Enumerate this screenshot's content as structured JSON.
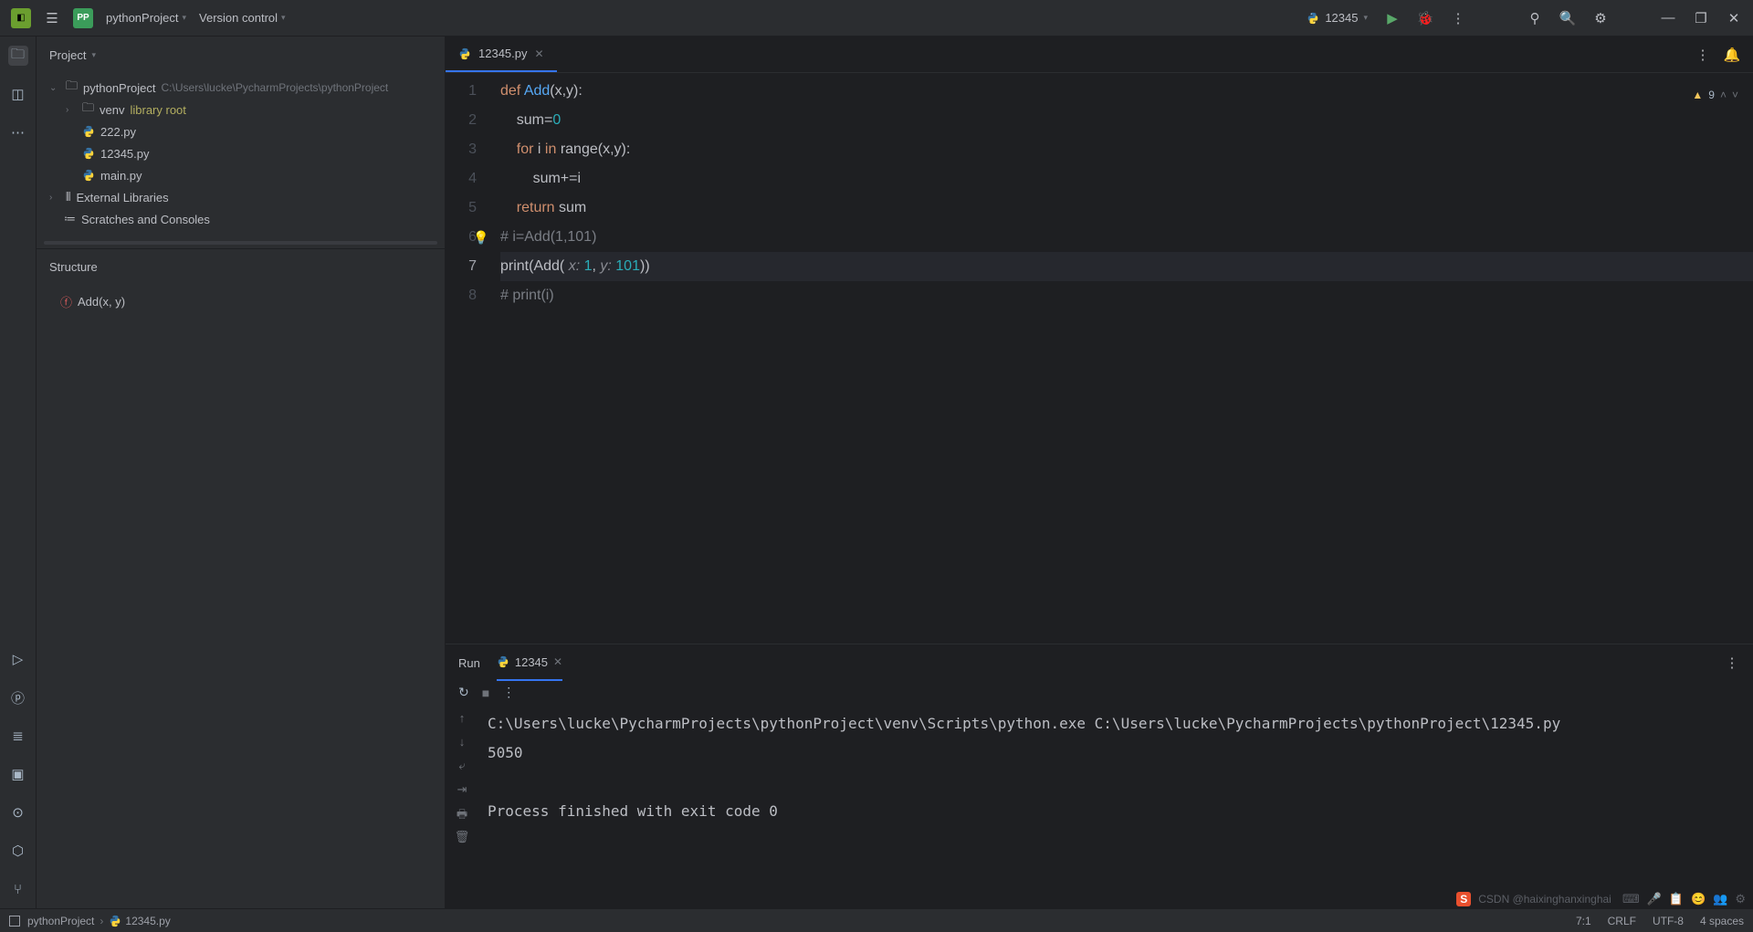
{
  "titlebar": {
    "project_name": "pythonProject",
    "version_control": "Version control",
    "run_config": "12345"
  },
  "sidebar": {
    "header": "Project",
    "project": {
      "name": "pythonProject",
      "path": "C:\\Users\\lucke\\PycharmProjects\\pythonProject"
    },
    "venv": {
      "name": "venv",
      "tag": "library root"
    },
    "files": [
      "222.py",
      "12345.py",
      "main.py"
    ],
    "external": "External Libraries",
    "scratches": "Scratches and Consoles",
    "structure_header": "Structure",
    "structure_item": "Add(x, y)"
  },
  "editor": {
    "tab": "12345.py",
    "warnings": "9",
    "lines": [
      {
        "n": "1",
        "segs": [
          {
            "t": "def ",
            "c": "kw"
          },
          {
            "t": "Add",
            "c": "fn"
          },
          {
            "t": "(x,y):",
            "c": ""
          }
        ]
      },
      {
        "n": "2",
        "segs": [
          {
            "t": "    sum=",
            "c": ""
          },
          {
            "t": "0",
            "c": "num"
          }
        ]
      },
      {
        "n": "3",
        "segs": [
          {
            "t": "    ",
            "c": ""
          },
          {
            "t": "for ",
            "c": "kw"
          },
          {
            "t": "i ",
            "c": ""
          },
          {
            "t": "in ",
            "c": "kw"
          },
          {
            "t": "range(x,y):",
            "c": ""
          }
        ]
      },
      {
        "n": "4",
        "segs": [
          {
            "t": "        sum+=i",
            "c": ""
          }
        ]
      },
      {
        "n": "5",
        "segs": [
          {
            "t": "    ",
            "c": ""
          },
          {
            "t": "return ",
            "c": "kw"
          },
          {
            "t": "sum",
            "c": ""
          }
        ]
      },
      {
        "n": "6",
        "segs": [
          {
            "t": "# i=Add(1,101)",
            "c": "comment"
          }
        ],
        "bulb": true
      },
      {
        "n": "7",
        "segs": [
          {
            "t": "print(Add( ",
            "c": ""
          },
          {
            "t": "x: ",
            "c": "param"
          },
          {
            "t": "1",
            "c": "num"
          },
          {
            "t": ", ",
            "c": ""
          },
          {
            "t": "y: ",
            "c": "param"
          },
          {
            "t": "101",
            "c": "num"
          },
          {
            "t": "))",
            "c": ""
          }
        ],
        "current": true
      },
      {
        "n": "8",
        "segs": [
          {
            "t": "# print(i)",
            "c": "comment"
          }
        ]
      }
    ]
  },
  "run": {
    "title": "Run",
    "tab": "12345",
    "output": "C:\\Users\\lucke\\PycharmProjects\\pythonProject\\venv\\Scripts\\python.exe C:\\Users\\lucke\\PycharmProjects\\pythonProject\\12345.py\n5050\n\nProcess finished with exit code 0"
  },
  "statusbar": {
    "breadcrumb_project": "pythonProject",
    "breadcrumb_file": "12345.py",
    "pos": "7:1",
    "eol": "CRLF",
    "encoding": "UTF-8",
    "indent": "4 spaces"
  },
  "watermark": "CSDN @haixinghanxinghai"
}
